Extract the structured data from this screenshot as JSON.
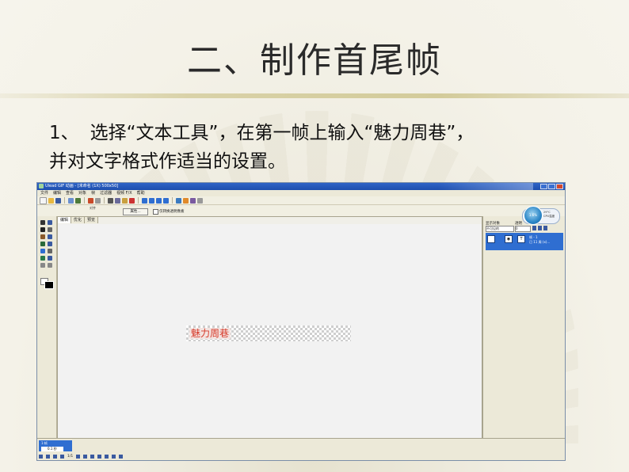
{
  "slide": {
    "title": "二、制作首尾帧",
    "step_number": "1、",
    "step_text_line1": "选择“文本工具”，在第一帧上输入“魅力周巷”，",
    "step_text_line2": "并对文字格式作适当的设置。"
  },
  "app": {
    "title": "Ulead GIF 动画 - [未命名 (1X) 500x50]",
    "menu": [
      "文件",
      "编辑",
      "查看",
      "对象",
      "帧",
      "过滤器",
      "视频 F/X",
      "帮助"
    ],
    "propbar": {
      "align_label": "对齐",
      "property_button": "属性...",
      "checkbox_label": "仅转换透明像素"
    },
    "tabs": [
      "编辑",
      "优化",
      "预览"
    ],
    "canvas_text": "魅力周巷",
    "panel": {
      "header_left": "显示对象",
      "header_right": "透明",
      "select_value": "不可见的",
      "opacity_value": "0",
      "layer_info_line1": "帧 - 1",
      "layer_info_line2": "已 11 周 (x)...",
      "gauge_temp": "29°C",
      "gauge_label": "CPU温度",
      "gauge_value": "1.6%"
    },
    "frames": {
      "frame_label": "1:帧",
      "frame_delay": "0.1 秒",
      "counter": "1/1"
    }
  }
}
